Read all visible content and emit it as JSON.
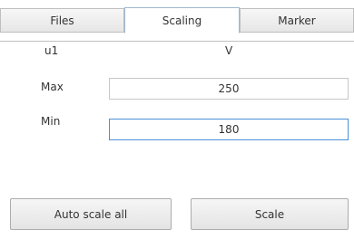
{
  "tabs": [
    {
      "label": "Files",
      "active": false
    },
    {
      "label": "Scaling",
      "active": true
    },
    {
      "label": "Marker",
      "active": false
    }
  ],
  "scaling": {
    "channel": "u1",
    "unit": "V",
    "max_label": "Max",
    "max_value": "250",
    "min_label": "Min",
    "min_value": "180"
  },
  "buttons": {
    "auto_scale_all": "Auto scale all",
    "scale": "Scale"
  },
  "colors": {
    "active_tab_border": "#9fb8cf",
    "focus_border": "#4a8fd9"
  }
}
